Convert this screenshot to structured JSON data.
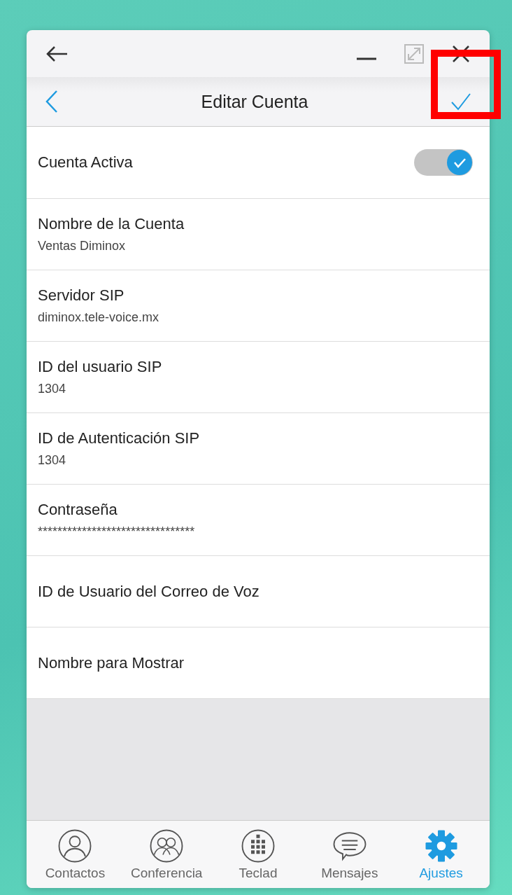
{
  "header": {
    "title": "Editar Cuenta",
    "save_highlighted": true
  },
  "toggle_row": {
    "label": "Cuenta Activa",
    "on": true
  },
  "fields": [
    {
      "label": "Nombre de la Cuenta",
      "value": "Ventas Diminox"
    },
    {
      "label": "Servidor SIP",
      "value": "diminox.tele-voice.mx"
    },
    {
      "label": "ID del usuario SIP",
      "value": "1304"
    },
    {
      "label": "ID de Autenticación SIP",
      "value": "1304"
    },
    {
      "label": "Contraseña",
      "value": "********************************"
    },
    {
      "label": "ID de Usuario del Correo de Voz"
    },
    {
      "label": "Nombre para Mostrar"
    }
  ],
  "tabs": [
    {
      "label": "Contactos",
      "selected": false
    },
    {
      "label": "Conferencia",
      "selected": false
    },
    {
      "label": "Teclad",
      "selected": false
    },
    {
      "label": "Mensajes",
      "selected": false
    },
    {
      "label": "Ajustes",
      "selected": true
    }
  ]
}
